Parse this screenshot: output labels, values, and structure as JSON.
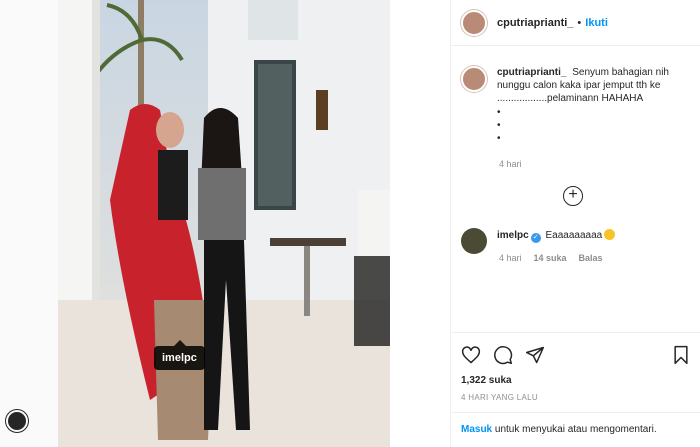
{
  "post": {
    "username": "cputriaprianti_",
    "follow_label": "Ikuti",
    "dot": "•",
    "photo_tag": "imelpc"
  },
  "caption": {
    "username": "cputriaprianti_",
    "text": "Senyum bahagian nih nunggu calon kaka ipar jemput tth ke ..................pelaminann HAHAHA",
    "bullets": "•\n•\n•",
    "time": "4 hari"
  },
  "more_comments_symbol": "+",
  "comment": {
    "username": "imelpc",
    "verified_symbol": "✓",
    "text": "Eaaaaaaaaa",
    "time": "4 hari",
    "likes": "14 suka",
    "reply": "Balas"
  },
  "actions": {
    "likes": "1,322 suka",
    "when": "4 HARI YANG LALU"
  },
  "login": {
    "link": "Masuk",
    "rest": " untuk menyukai atau mengomentari."
  }
}
